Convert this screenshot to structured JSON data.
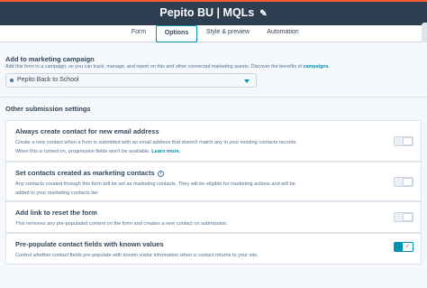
{
  "header": {
    "title": "Pepito BU | MQLs",
    "edit_icon": "pencil-icon"
  },
  "tabs": [
    {
      "label": "Form",
      "active": false
    },
    {
      "label": "Options",
      "active": true
    },
    {
      "label": "Style & preview",
      "active": false
    },
    {
      "label": "Automation",
      "active": false
    }
  ],
  "campaign": {
    "title": "Add to marketing campaign",
    "help_text": "Add this form to a campaign, so you can track, manage, and report on this and other connected marketing assets. Discover the benefits of",
    "help_link": "campaigns",
    "help_end": ".",
    "selected": "Pepito Back to School"
  },
  "other_settings": {
    "title": "Other submission settings",
    "items": [
      {
        "title": "Always create contact for new email address",
        "line1": "Create a new contact when a form is submitted with an email address that doesn't match any in your existing contacts records.",
        "line2": "When this is turned on, progressive fields won't be available.",
        "link": "Learn more.",
        "enabled": false
      },
      {
        "title": "Set contacts created as marketing contacts",
        "line1": "Any contacts created through this form will be set as marketing contacts. They will be eligible for marketing actions and will be",
        "line2": "added to your marketing contacts tier.",
        "info_icon": "info-icon",
        "enabled": false
      },
      {
        "title": "Add link to reset the form",
        "line1": "This removes any pre-populated content on the form and creates a new contact on submission.",
        "enabled": false
      },
      {
        "title": "Pre-populate contact fields with known values",
        "line1": "Control whether contact fields pre-populate with known visitor information when a contact returns to your site.",
        "enabled": true
      }
    ]
  },
  "colors": {
    "header_bg": "#2d3e50",
    "accent": "#0091ae",
    "brand": "#ff5c35"
  }
}
